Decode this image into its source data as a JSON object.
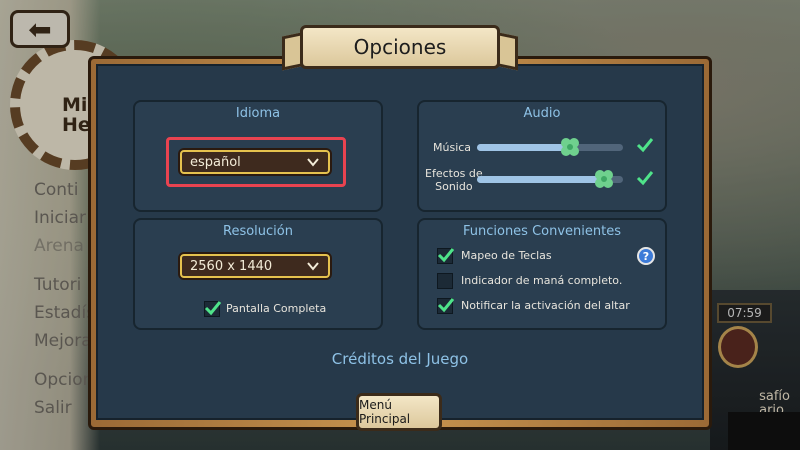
{
  "background": {
    "menu_items": [
      "Conti",
      "Iniciar",
      "Arena",
      "Tutori",
      "Estadís",
      "Mejora",
      "Opcion",
      "Salir"
    ],
    "gear_text": "Mi\nHe",
    "timer": "07:59",
    "challenge": "safío\nario"
  },
  "dialog": {
    "title": "Opciones",
    "idioma": {
      "title": "Idioma",
      "selected": "español"
    },
    "audio": {
      "title": "Audio",
      "musica_label": "Música",
      "musica_level": 0.64,
      "musica_enabled": true,
      "efectos_label": "Efectos de\nSonido",
      "efectos_level": 0.87,
      "efectos_enabled": true
    },
    "resolucion": {
      "title": "Resolución",
      "selected": "2560 x 1440",
      "fullscreen_label": "Pantalla Completa",
      "fullscreen_enabled": true
    },
    "funciones": {
      "title": "Funciones Convenientes",
      "items": [
        {
          "label": "Mapeo de Teclas",
          "checked": true,
          "help": "?"
        },
        {
          "label": "Indicador de maná completo.",
          "checked": false
        },
        {
          "label": "Notificar la activación del altar",
          "checked": true
        }
      ]
    },
    "credits": "Créditos del Juego",
    "main_menu_button": "Menú Principal"
  },
  "colors": {
    "accent_title": "#8ec2e6",
    "dropdown_border": "#e5c24e",
    "highlight": "#e94350",
    "check": "#4fe38a"
  }
}
